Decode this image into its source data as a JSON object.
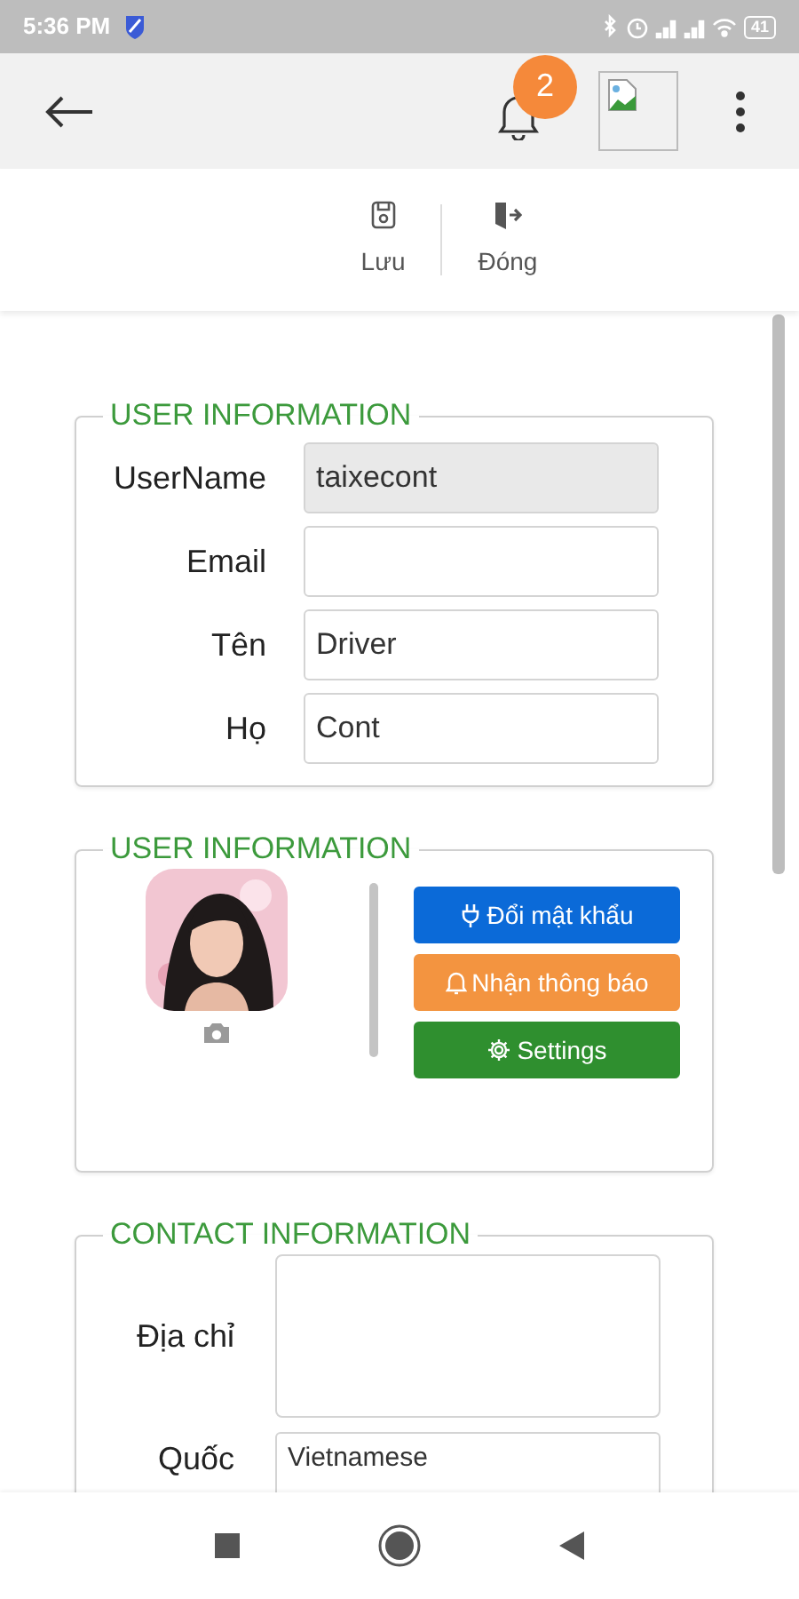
{
  "status_bar": {
    "time": "5:36 PM",
    "battery": "41"
  },
  "app_bar": {
    "notification_count": "2"
  },
  "toolbar": [
    {
      "label": "Lưu",
      "kind": "save"
    },
    {
      "label": "Đóng",
      "kind": "close"
    }
  ],
  "sections": [
    {
      "kind": "form",
      "title": "USER INFORMATION",
      "fields": [
        {
          "label": "UserName",
          "value": "taixecont",
          "disabled": true
        },
        {
          "label": "Email",
          "disabled": false
        },
        {
          "label": "Tên",
          "value": "Driver",
          "disabled": false
        },
        {
          "label": "Họ",
          "value": "Cont",
          "disabled": false
        }
      ]
    },
    {
      "kind": "profile",
      "title": "USER INFORMATION",
      "avatar": {
        "kind": "picture"
      },
      "buttons": [
        {
          "label": "Đổi mật khẩu",
          "kind": "plug",
          "color": "#0b6ad8"
        },
        {
          "label": "Nhận thông báo",
          "kind": "bell",
          "color": "#f39440"
        },
        {
          "label": "Settings",
          "kind": "gear",
          "color": "#2f8f2f"
        }
      ]
    },
    {
      "kind": "contact",
      "title": "CONTACT INFORMATION",
      "fields": [
        {
          "label": "Địa chỉ",
          "kind": "textarea"
        },
        {
          "label": "Quốc",
          "kind": "input",
          "value": "Vietnamese"
        }
      ]
    }
  ]
}
